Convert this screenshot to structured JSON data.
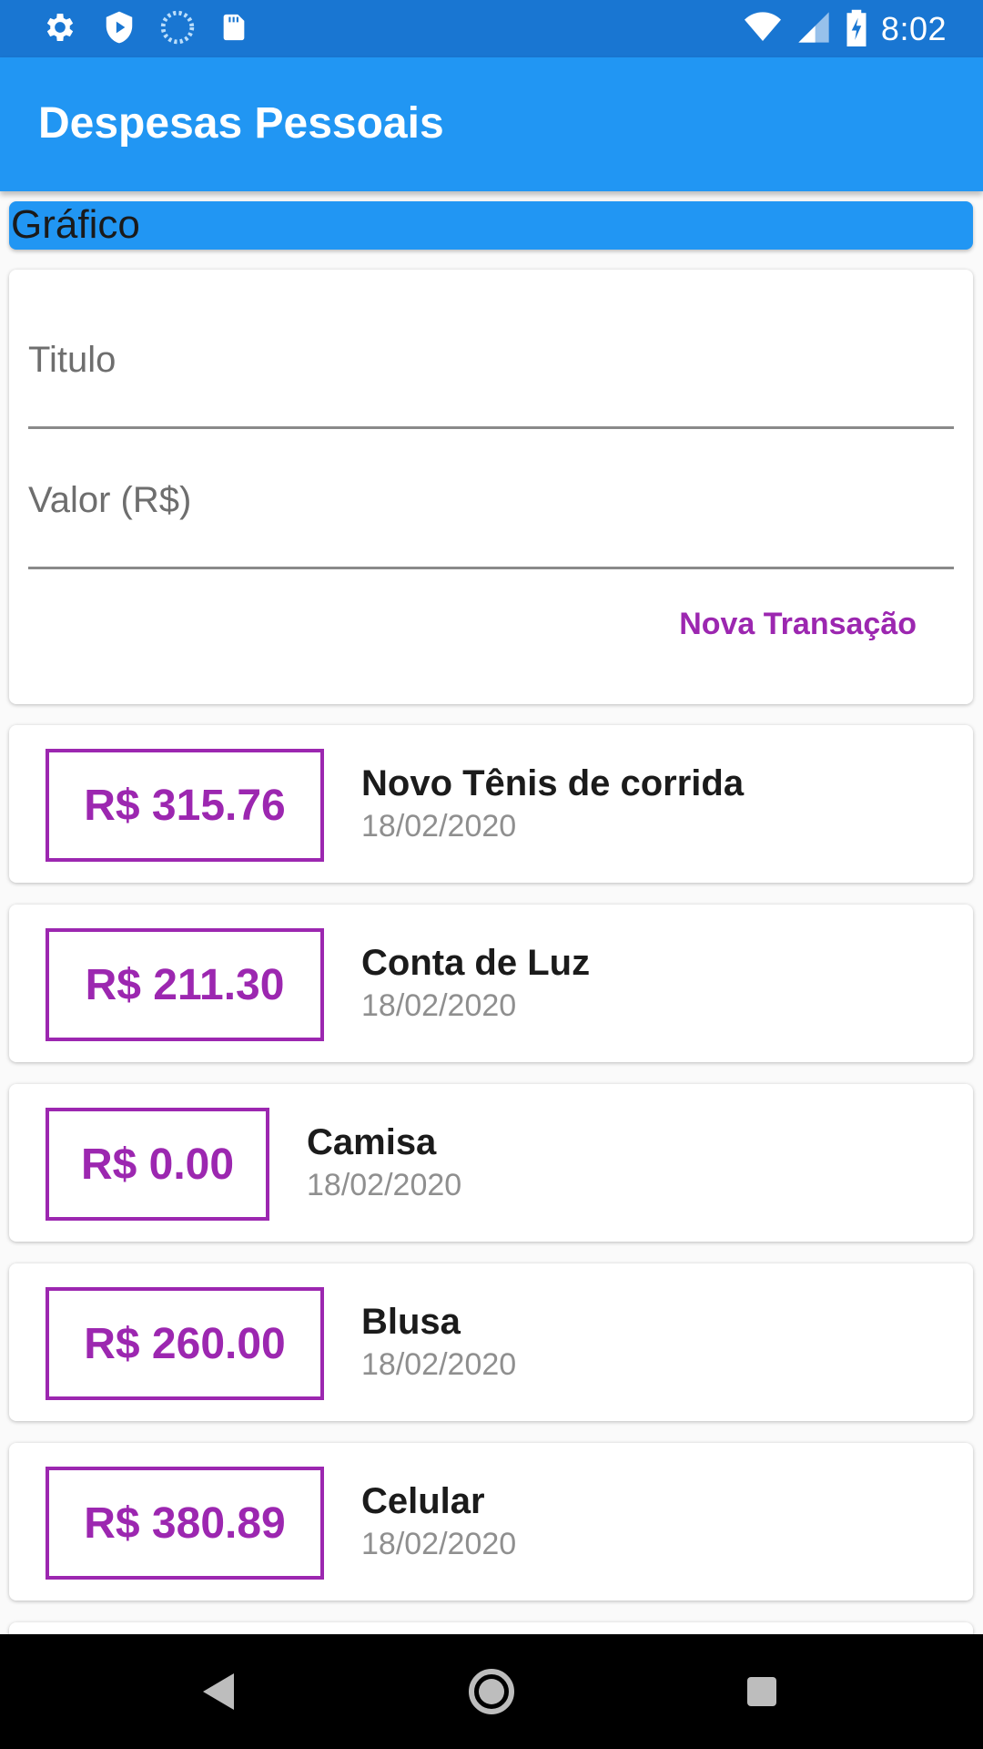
{
  "status_bar": {
    "time": "8:02",
    "icons": [
      "gear-icon",
      "shield-icon",
      "loading-icon",
      "sd-card-icon",
      "wifi-icon",
      "signal-icon",
      "battery-charging-icon"
    ]
  },
  "app_bar": {
    "title": "Despesas Pessoais"
  },
  "chart": {
    "label": "Gráfico"
  },
  "form": {
    "title_placeholder": "Titulo",
    "value_placeholder": "Valor (R$)",
    "submit_label": "Nova Transação"
  },
  "transactions": [
    {
      "amount": "R$ 315.76",
      "title": "Novo Tênis de corrida",
      "date": "18/02/2020"
    },
    {
      "amount": "R$ 211.30",
      "title": "Conta de Luz",
      "date": "18/02/2020"
    },
    {
      "amount": "R$ 0.00",
      "title": "Camisa",
      "date": "18/02/2020"
    },
    {
      "amount": "R$ 260.00",
      "title": "Blusa",
      "date": "18/02/2020"
    },
    {
      "amount": "R$ 380.89",
      "title": "Celular",
      "date": "18/02/2020"
    }
  ],
  "colors": {
    "primary": "#2196f3",
    "status_bar": "#1976d2",
    "accent": "#9c27b0"
  },
  "nav_bar": {
    "icons": [
      "back-icon",
      "home-icon",
      "recents-icon"
    ]
  }
}
